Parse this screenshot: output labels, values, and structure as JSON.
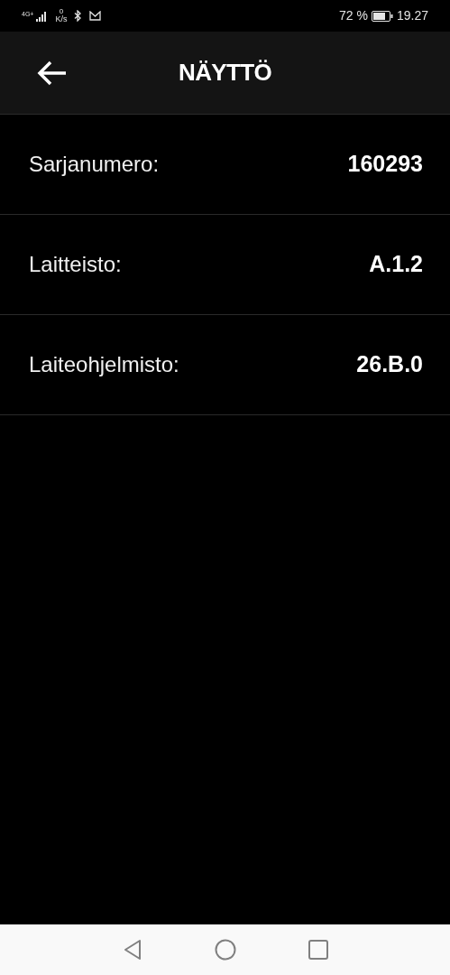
{
  "status_bar": {
    "network": "4G+",
    "speed_value": "0",
    "speed_unit": "K/s",
    "battery_percent": "72 %",
    "time": "19.27"
  },
  "header": {
    "title": "NÄYTTÖ"
  },
  "rows": [
    {
      "label": "Sarjanumero:",
      "value": "160293"
    },
    {
      "label": "Laitteisto:",
      "value": "A.1.2"
    },
    {
      "label": "Laiteohjelmisto:",
      "value": "26.B.0"
    }
  ]
}
